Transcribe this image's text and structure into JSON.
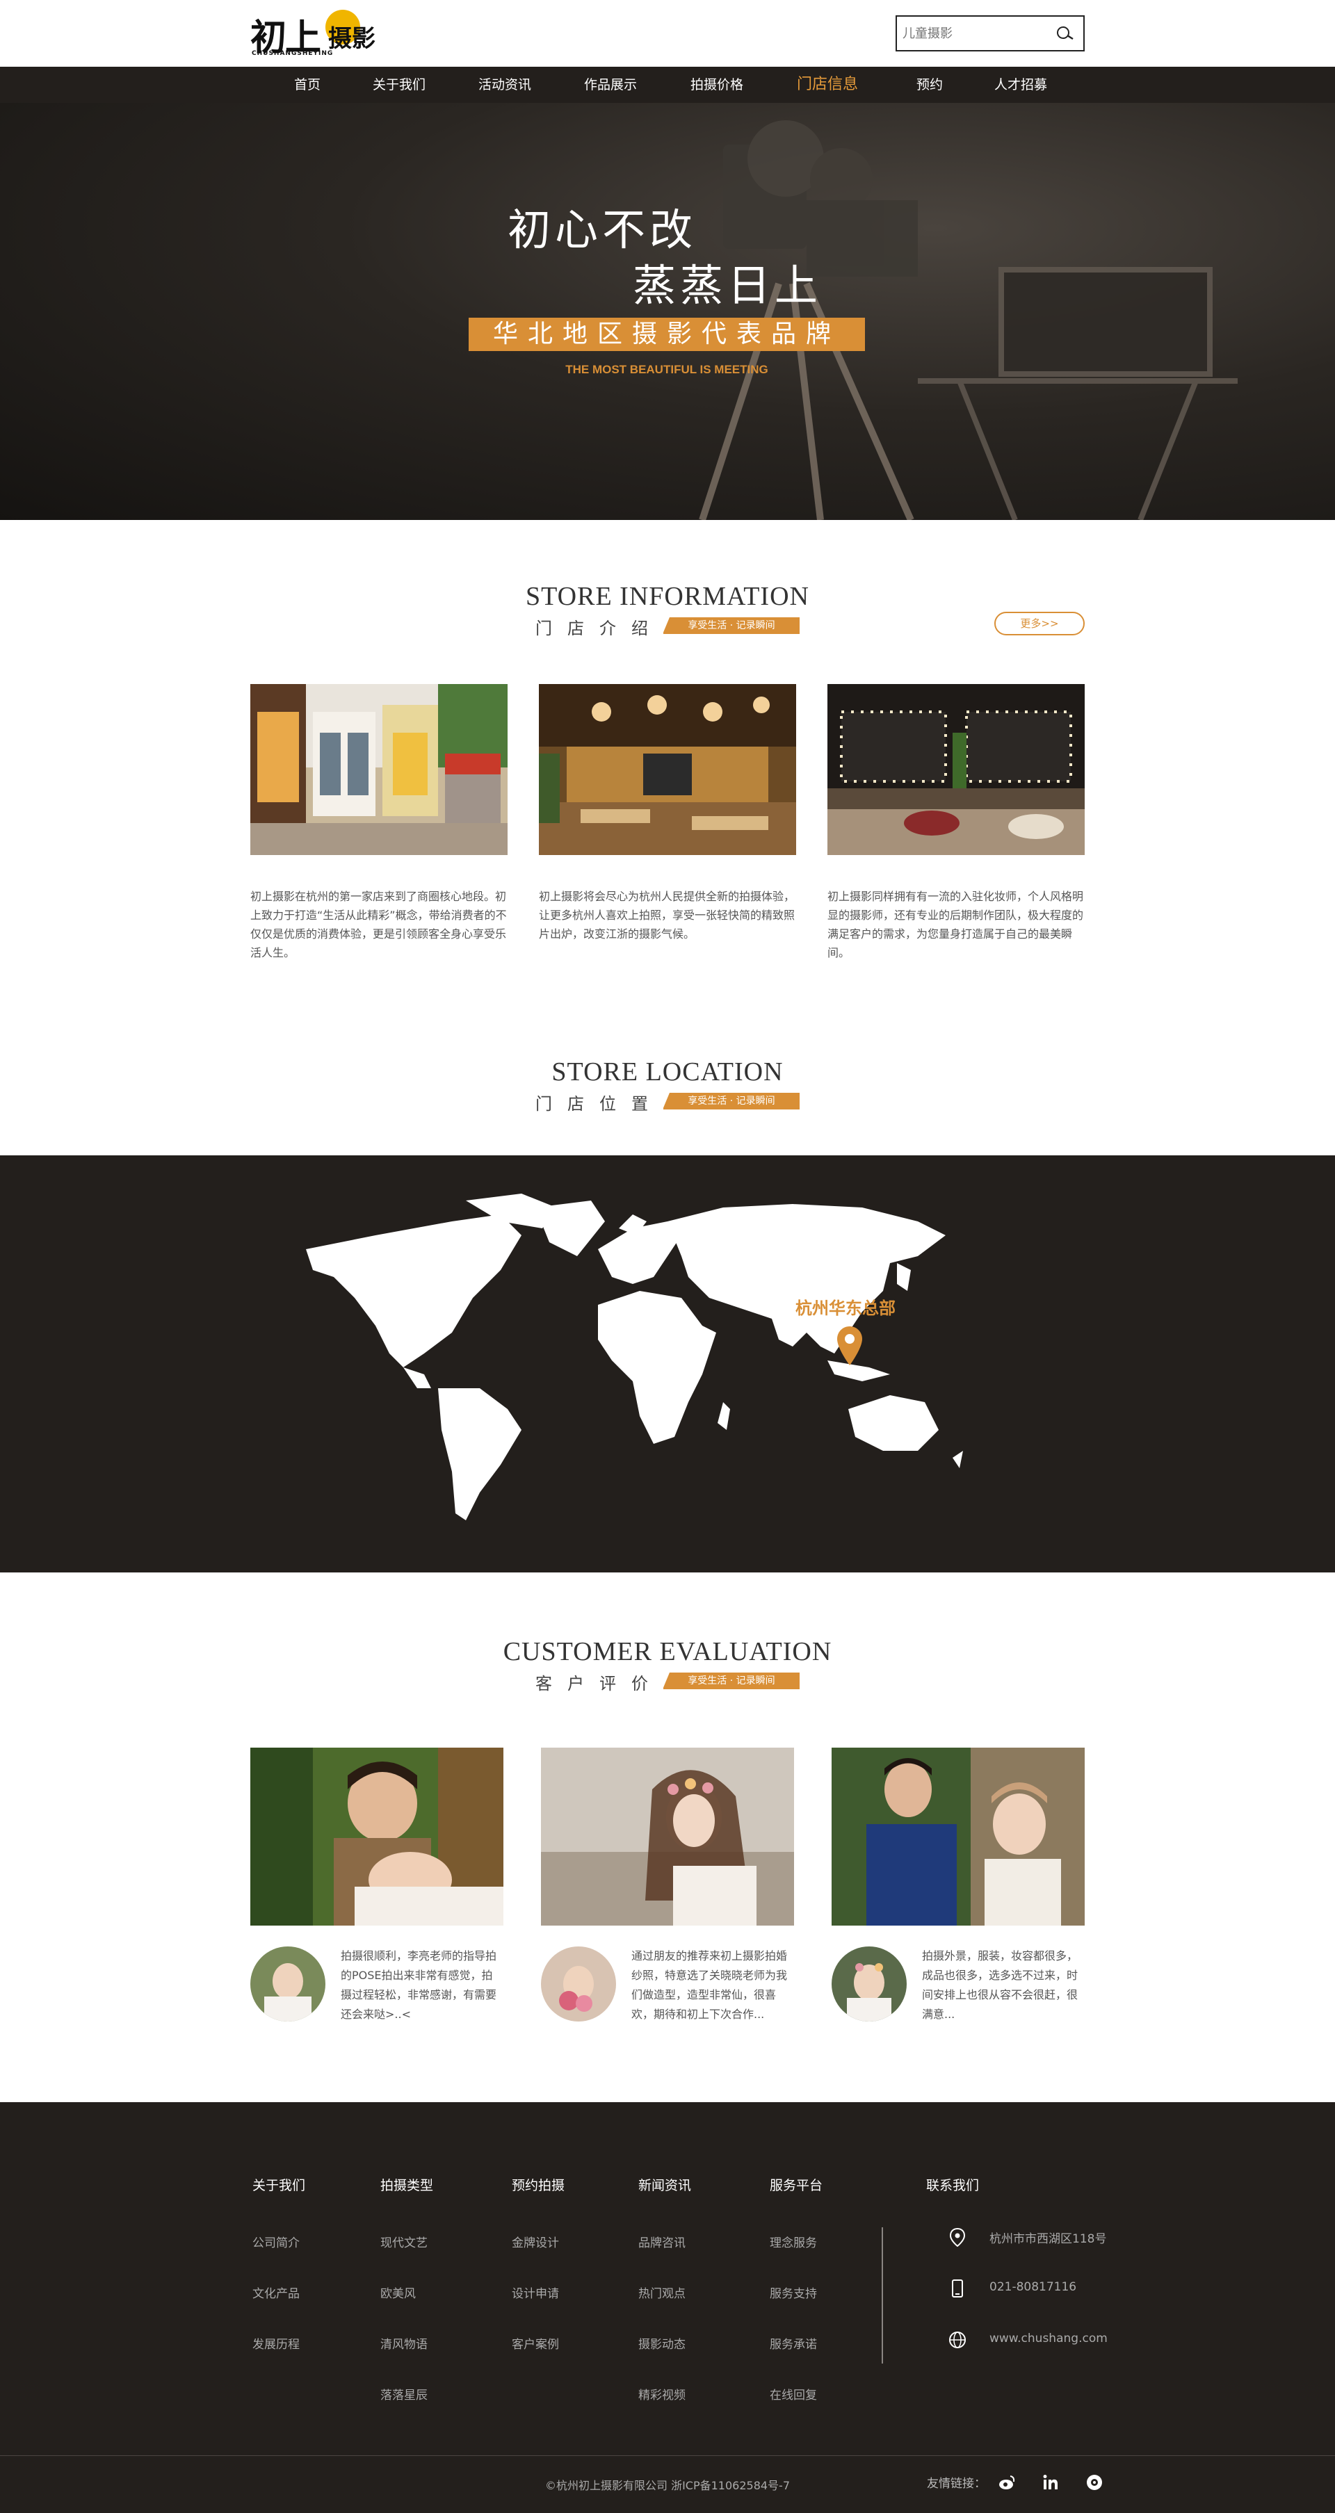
{
  "header": {
    "logo_main": "初上",
    "logo_sub": "摄影",
    "logo_en": "CHUSHANGSHEYING",
    "search_placeholder": "儿童摄影"
  },
  "nav": {
    "items": [
      "首页",
      "关于我们",
      "活动资讯",
      "作品展示",
      "拍摄价格",
      "门店信息",
      "预约",
      "人才招募"
    ],
    "active": "门店信息"
  },
  "hero": {
    "line1": "初心不改",
    "line2": "蒸蒸日上",
    "brand": "华北地区摄影代表品牌",
    "sub": "THE MOST BEAUTIFUL IS MEETING"
  },
  "store_info": {
    "title_en": "STORE INFORMATION",
    "title_cn": "门店介绍",
    "tag": "享受生活 · 记录瞬间",
    "more": "更多>>",
    "cards": [
      {
        "text": "初上摄影在杭州的第一家店来到了商圈核心地段。初上致力于打造“生活从此精彩”概念，带给消费者的不仅仅是优质的消费体验，更是引领顾客全身心享受乐活人生。"
      },
      {
        "text": "初上摄影将会尽心为杭州人民提供全新的拍摄体验，让更多杭州人喜欢上拍照，享受一张轻快简的精致照片出炉，改变江浙的摄影气候。"
      },
      {
        "text": "初上摄影同样拥有有一流的入驻化妆师，个人风格明显的摄影师，还有专业的后期制作团队，极大程度的满足客户的需求，为您量身打造属于自己的最美瞬间。"
      }
    ]
  },
  "store_location": {
    "title_en": "STORE LOCATION",
    "title_cn": "门店位置",
    "tag": "享受生活 · 记录瞬间",
    "pin_label": "杭州华东总部"
  },
  "evaluation": {
    "title_en": "CUSTOMER EVALUATION",
    "title_cn": "客户评价",
    "tag": "享受生活 · 记录瞬间",
    "cards": [
      {
        "text": "拍摄很顺利，李亮老师的指导拍的POSE拍出来非常有感觉，拍摄过程轻松，非常感谢，有需要还会来哒>..<"
      },
      {
        "text": "通过朋友的推荐来初上摄影拍婚纱照，特意选了关晓晓老师为我们做造型，造型非常仙，很喜欢，期待和初上下次合作..."
      },
      {
        "text": "拍摄外景，服装，妆容都很多，成品也很多，选多选不过来，时间安排上也很从容不会很赶，很满意..."
      }
    ]
  },
  "footer": {
    "columns": [
      {
        "heading": "关于我们",
        "items": [
          "公司简介",
          "文化产品",
          "发展历程"
        ]
      },
      {
        "heading": "拍摄类型",
        "items": [
          "现代文艺",
          "欧美风",
          "清风物语",
          "落落星辰"
        ]
      },
      {
        "heading": "预约拍摄",
        "items": [
          "金牌设计",
          "设计申请",
          "客户案例"
        ]
      },
      {
        "heading": "新闻资讯",
        "items": [
          "品牌咨讯",
          "热门观点",
          "摄影动态",
          "精彩视频"
        ]
      },
      {
        "heading": "服务平台",
        "items": [
          "理念服务",
          "服务支持",
          "服务承诺",
          "在线回复"
        ]
      }
    ],
    "contact_heading": "联系我们",
    "address": "杭州市市西湖区118号",
    "phone": "021-80817116",
    "website": "www.chushang.com",
    "copyright": "©杭州初上摄影有限公司 浙ICP备11062584号-7",
    "friend_links": "友情链接："
  }
}
